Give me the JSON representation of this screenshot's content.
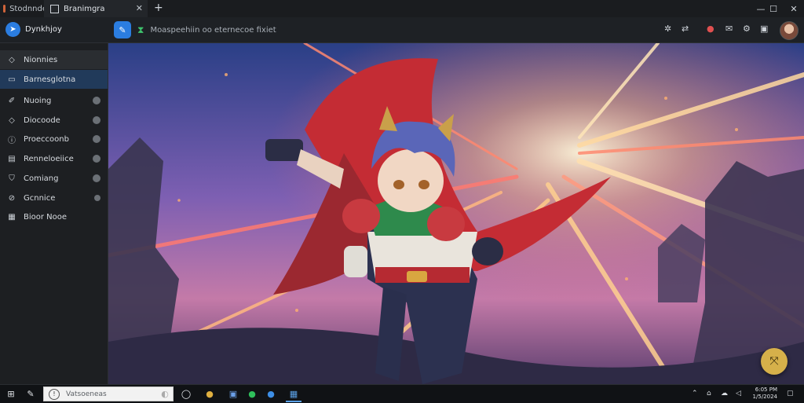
{
  "window": {
    "tabs": [
      {
        "label": "Stodnnde"
      },
      {
        "label": "Branimgra"
      }
    ],
    "new_tab": "+",
    "controls": {
      "minimize": "—",
      "maximize": "☐",
      "close": "✕"
    }
  },
  "header": {
    "app_name": "Dynkhjoy",
    "address_text": "Moaspeehiin oo eternecoe fixiet"
  },
  "sidebar": {
    "items": [
      {
        "label": "Nionnies",
        "icon": "tag-icon"
      },
      {
        "label": "Barnesglotna",
        "icon": "chat-icon"
      },
      {
        "label": "Nuoing",
        "icon": "pin-icon"
      },
      {
        "label": "Diocoode",
        "icon": "tag-icon"
      },
      {
        "label": "Proeccoonb",
        "icon": "info-icon"
      },
      {
        "label": "Renneloeiice",
        "icon": "document-icon"
      },
      {
        "label": "Comiang",
        "icon": "shield-icon"
      },
      {
        "label": "Gcnnice",
        "icon": "link-icon"
      },
      {
        "label": "Bioor Nooe",
        "icon": "grid-icon"
      }
    ]
  },
  "taskbar": {
    "search_placeholder": "Vatsoeneas",
    "clock_time": "6:05 PM",
    "clock_date": "1/5/2024"
  },
  "colors": {
    "accent": "#2b7de0",
    "active_item": "#213a5a",
    "fab": "#d6b04a"
  }
}
